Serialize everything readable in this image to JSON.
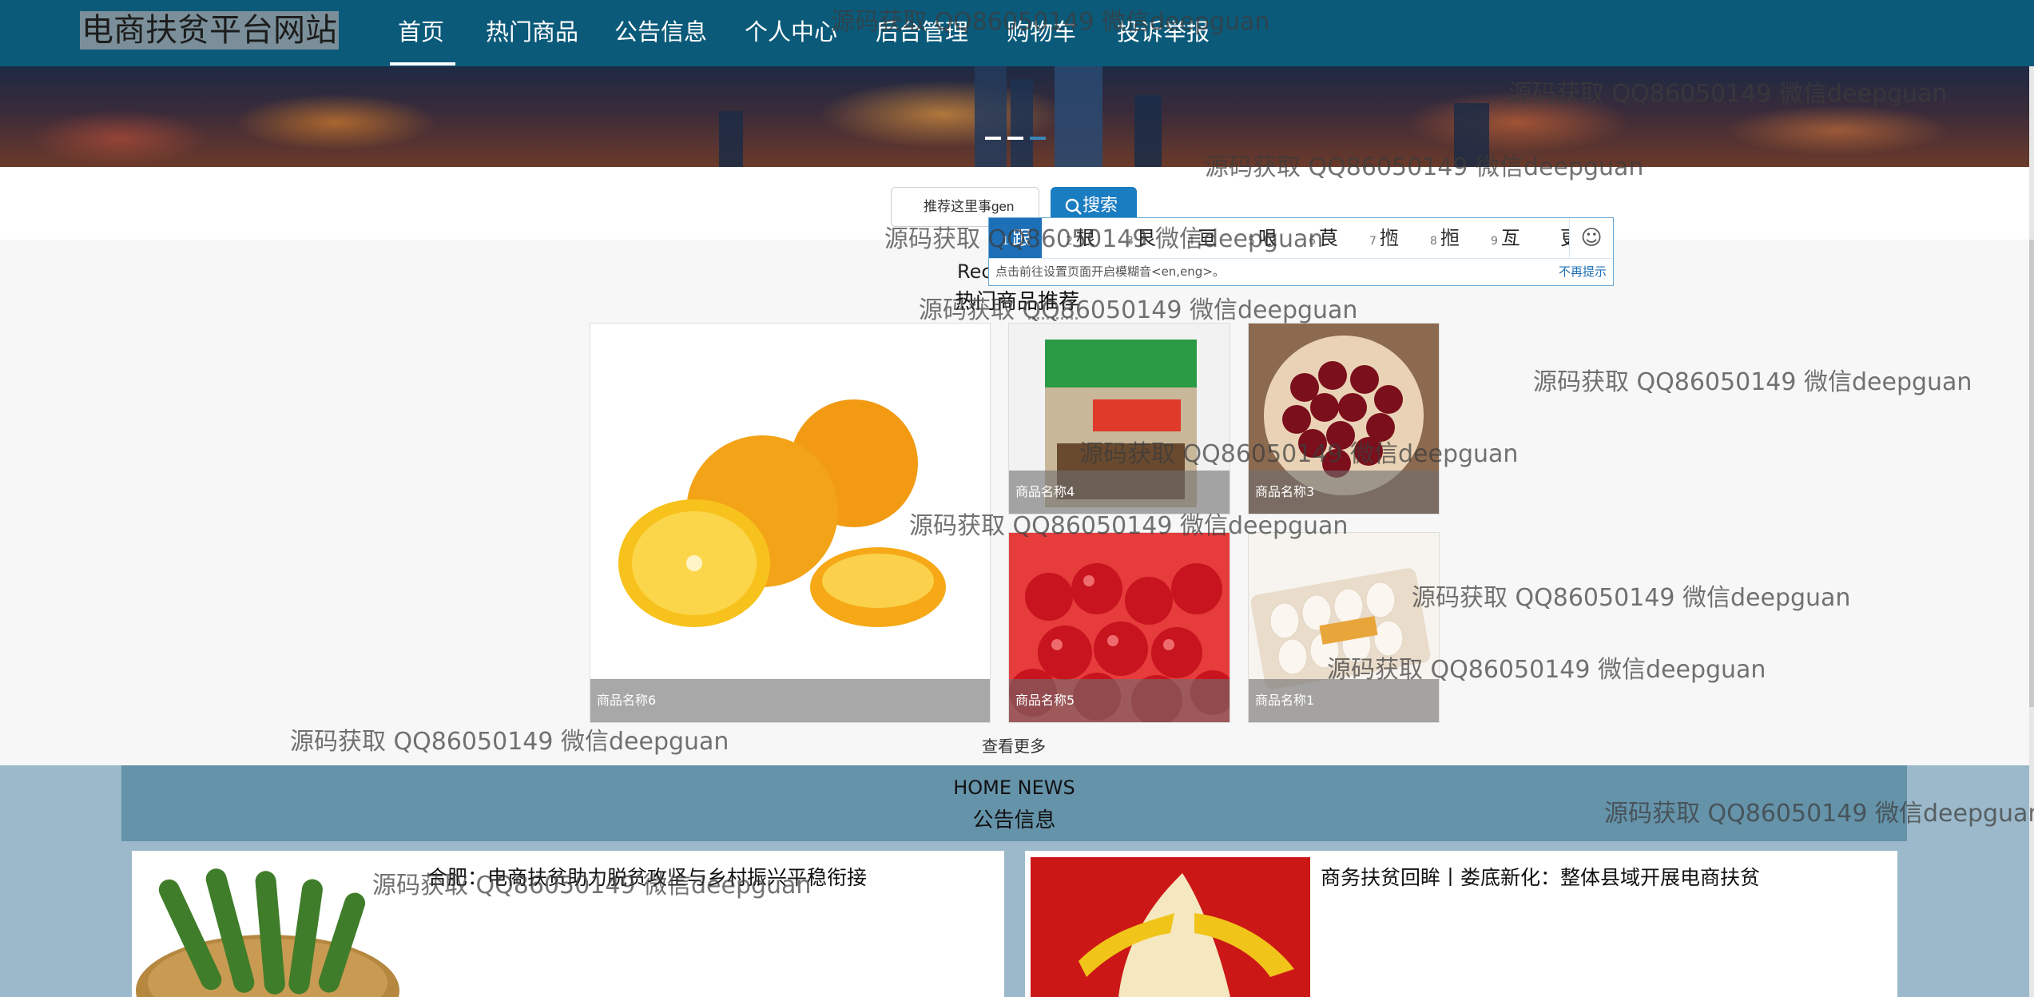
{
  "brand": "电商扶贫平台网站",
  "nav": {
    "items": [
      {
        "label": "首页"
      },
      {
        "label": "热门商品"
      },
      {
        "label": "公告信息"
      },
      {
        "label": "个人中心"
      },
      {
        "label": "后台管理"
      },
      {
        "label": "购物车"
      },
      {
        "label": "投诉举报"
      }
    ],
    "active": "首页"
  },
  "search": {
    "placeholder": "推荐这里事gen",
    "value": "推荐这里事gen",
    "button_label": "搜索"
  },
  "ime": {
    "candidates": [
      {
        "num": "1",
        "text": "跟"
      },
      {
        "num": "2",
        "text": "根"
      },
      {
        "num": "3",
        "text": "艮"
      },
      {
        "num": "4",
        "text": "亘"
      },
      {
        "num": "5",
        "text": "哏"
      },
      {
        "num": "6",
        "text": "茛"
      },
      {
        "num": "7",
        "text": "揯"
      },
      {
        "num": "8",
        "text": "搄"
      },
      {
        "num": "9",
        "text": "亙"
      },
      {
        "num": "",
        "text": "更"
      }
    ],
    "tip": "点击前往设置页面开启模糊音<en,eng>。",
    "dismiss": "不再提示"
  },
  "products": {
    "heading_en": "Rec",
    "heading": "热门商品推荐",
    "items": [
      {
        "name": "商品名称6"
      },
      {
        "name": "商品名称4"
      },
      {
        "name": "商品名称3"
      },
      {
        "name": "商品名称5"
      },
      {
        "name": "商品名称1"
      }
    ],
    "more": "查看更多"
  },
  "news": {
    "heading_en": "HOME NEWS",
    "heading": "公告信息",
    "items": [
      {
        "title": "合肥：电商扶贫助力脱贫攻坚与乡村振兴平稳衔接"
      },
      {
        "title": "商务扶贫回眸丨娄底新化：整体县域开展电商扶贫"
      }
    ]
  },
  "watermark": "源码获取 QQ86050149 微信deepguan",
  "colors": {
    "nav": "#0b5a7a",
    "search_button": "#1a7cc1",
    "news_header": "#6593aa",
    "news_bg": "#9bb9ca"
  }
}
